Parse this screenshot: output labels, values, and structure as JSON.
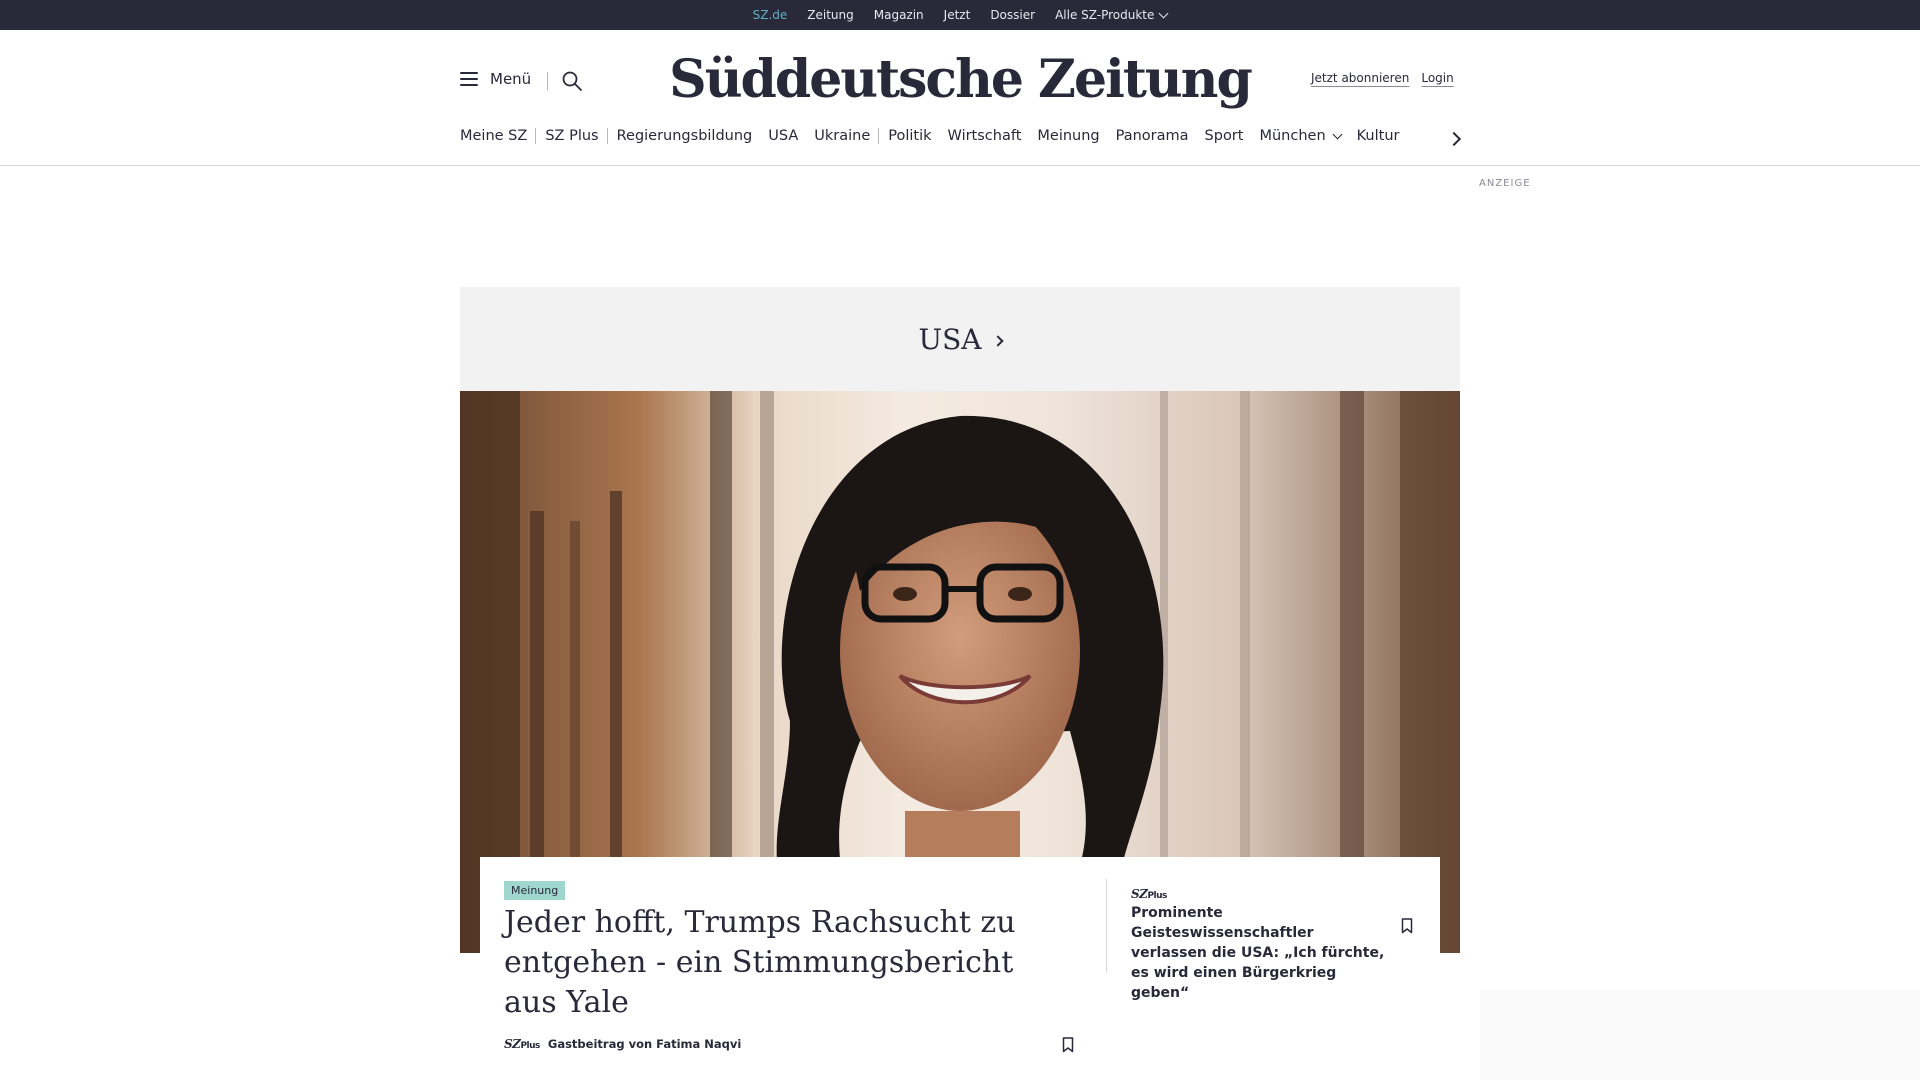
{
  "topbar": {
    "items": [
      {
        "label": "SZ.de"
      },
      {
        "label": "Zeitung"
      },
      {
        "label": "Magazin"
      },
      {
        "label": "Jetzt"
      },
      {
        "label": "Dossier"
      },
      {
        "label": "Alle SZ-Produkte"
      }
    ],
    "active_color": "#5fb0c2",
    "background": "#29293a"
  },
  "header": {
    "menu_label": "Menü",
    "logo": "Süddeutsche Zeitung",
    "subscribe_label": "Jetzt abonnieren",
    "login_label": "Login",
    "icons": [
      "hamburger-icon",
      "search-icon"
    ]
  },
  "nav": {
    "items": [
      {
        "label": "Meine SZ"
      },
      {
        "label": "SZ Plus"
      },
      {
        "label": "Regierungsbildung"
      },
      {
        "label": "USA"
      },
      {
        "label": "Ukraine"
      },
      {
        "label": "Politik"
      },
      {
        "label": "Wirtschaft"
      },
      {
        "label": "Meinung"
      },
      {
        "label": "Panorama"
      },
      {
        "label": "Sport"
      },
      {
        "label": "München"
      },
      {
        "label": "Kultur"
      }
    ]
  },
  "ad": {
    "label": "ANZEIGE"
  },
  "section": {
    "title": "USA"
  },
  "teaser": {
    "badge": "Meinung",
    "badge_color": "#9fd7cf",
    "headline": "Jeder hofft, Trumps Rachsucht zu entgehen - ein Stimmungsbericht aus Yale",
    "plus_label_sz": "SZ",
    "plus_label_plus": "Plus",
    "author": "Gastbeitrag von Fatima Naqvi"
  },
  "side_teaser": {
    "plus_label_sz": "SZ",
    "plus_label_plus": "Plus",
    "title": "Prominente Geisteswissenschaftler verlassen die USA: „Ich fürchte, es wird einen Bürgerkrieg geben“"
  }
}
